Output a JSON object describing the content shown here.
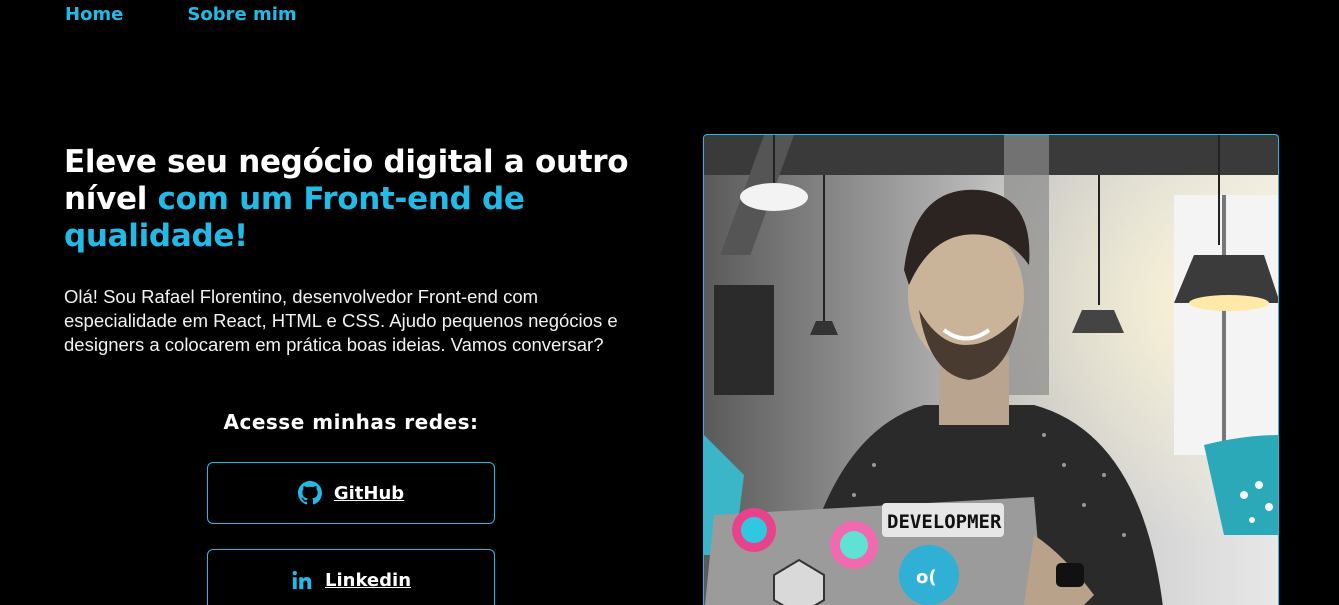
{
  "nav": {
    "items": [
      {
        "label": "Home"
      },
      {
        "label": "Sobre mim"
      }
    ]
  },
  "hero": {
    "title_part1": "Eleve seu negócio digital a outro nível ",
    "title_accent": "com um Front-end de qualidade!",
    "intro": "Olá! Sou Rafael Florentino, desenvolvedor Front-end com especialidade em React, HTML e CSS. Ajudo pequenos negócios e designers a colocarem em prática boas ideias. Vamos conversar?"
  },
  "social": {
    "heading": "Acesse minhas redes:",
    "buttons": [
      {
        "label": "GitHub",
        "icon": "github-icon"
      },
      {
        "label": "Linkedin",
        "icon": "linkedin-icon"
      }
    ]
  },
  "photo": {
    "laptop_sticker_text": "DEVELOPMER"
  },
  "colors": {
    "accent": "#22bbe8",
    "background": "#000000",
    "text": "#ffffff"
  }
}
